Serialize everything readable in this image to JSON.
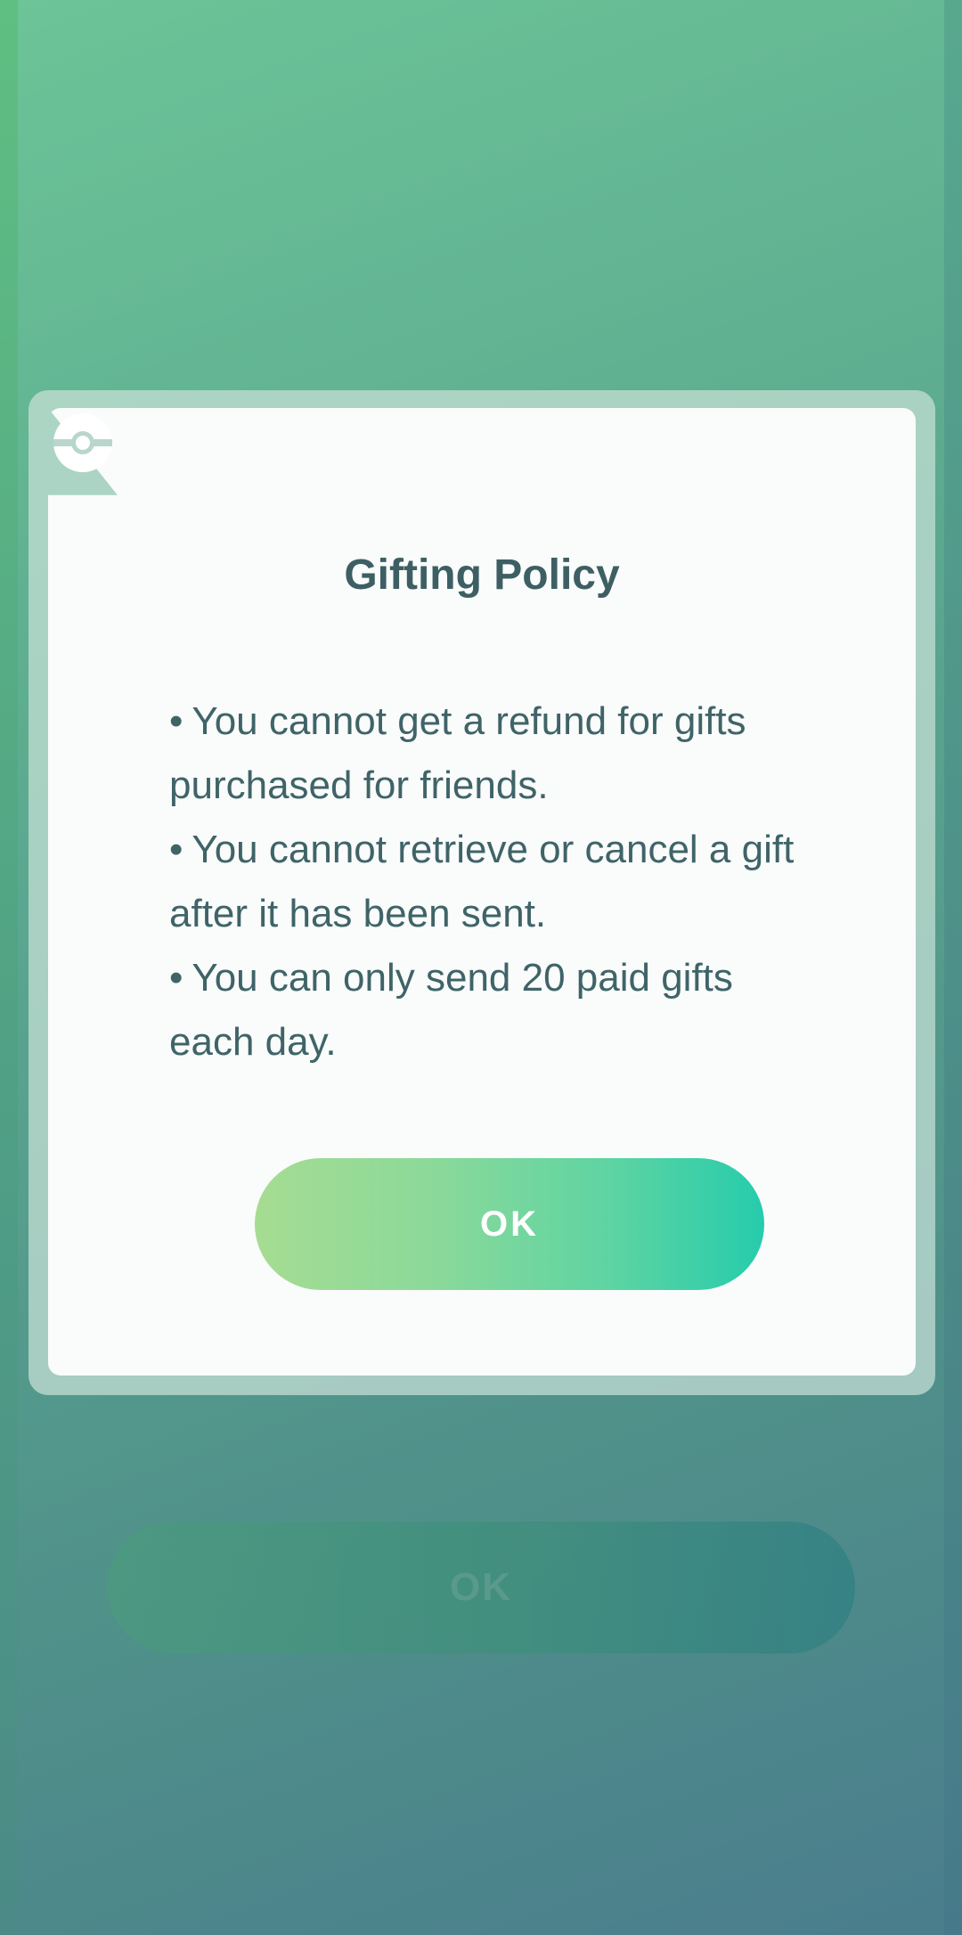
{
  "dialog": {
    "title": "Gifting Policy",
    "items": [
      "You cannot get a refund for gifts purchased for friends.",
      "You cannot retrieve or cancel a gift after it has been sent.",
      "You can only send 20 paid gifts each day."
    ],
    "bullet": "•",
    "ok_label": "OK",
    "icon": "pokeball-icon"
  },
  "background": {
    "ok_label": "OK"
  },
  "colors": {
    "title": "#3d5f63",
    "text": "#3f6468",
    "button_start": "#a6dc92",
    "button_end": "#26ccac",
    "card": "#fafbfb"
  }
}
